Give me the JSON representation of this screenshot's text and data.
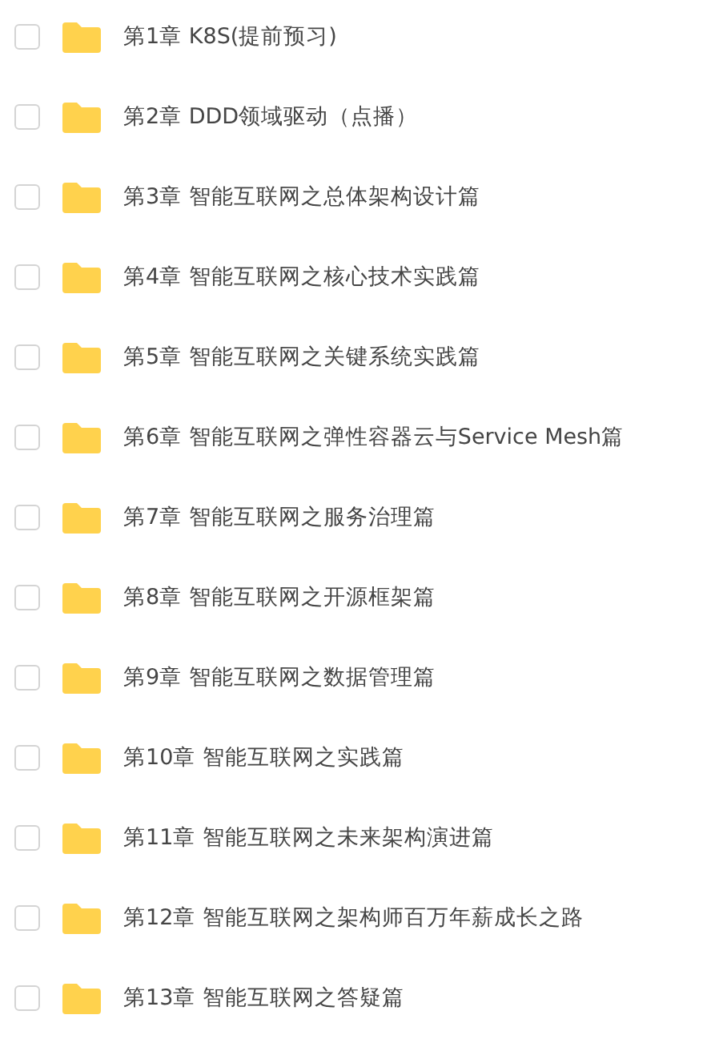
{
  "items": [
    {
      "label": "第1章 K8S(提前预习)",
      "checked": false
    },
    {
      "label": "第2章 DDD领域驱动（点播）",
      "checked": false
    },
    {
      "label": "第3章 智能互联网之总体架构设计篇",
      "checked": false
    },
    {
      "label": "第4章 智能互联网之核心技术实践篇",
      "checked": false
    },
    {
      "label": "第5章 智能互联网之关键系统实践篇",
      "checked": false
    },
    {
      "label": "第6章 智能互联网之弹性容器云与Service Mesh篇",
      "checked": false
    },
    {
      "label": "第7章 智能互联网之服务治理篇",
      "checked": false
    },
    {
      "label": "第8章 智能互联网之开源框架篇",
      "checked": false
    },
    {
      "label": "第9章 智能互联网之数据管理篇",
      "checked": false
    },
    {
      "label": "第10章 智能互联网之实践篇",
      "checked": false
    },
    {
      "label": "第11章 智能互联网之未来架构演进篇",
      "checked": false
    },
    {
      "label": "第12章 智能互联网之架构师百万年薪成长之路",
      "checked": false
    },
    {
      "label": "第13章 智能互联网之答疑篇",
      "checked": false
    }
  ]
}
